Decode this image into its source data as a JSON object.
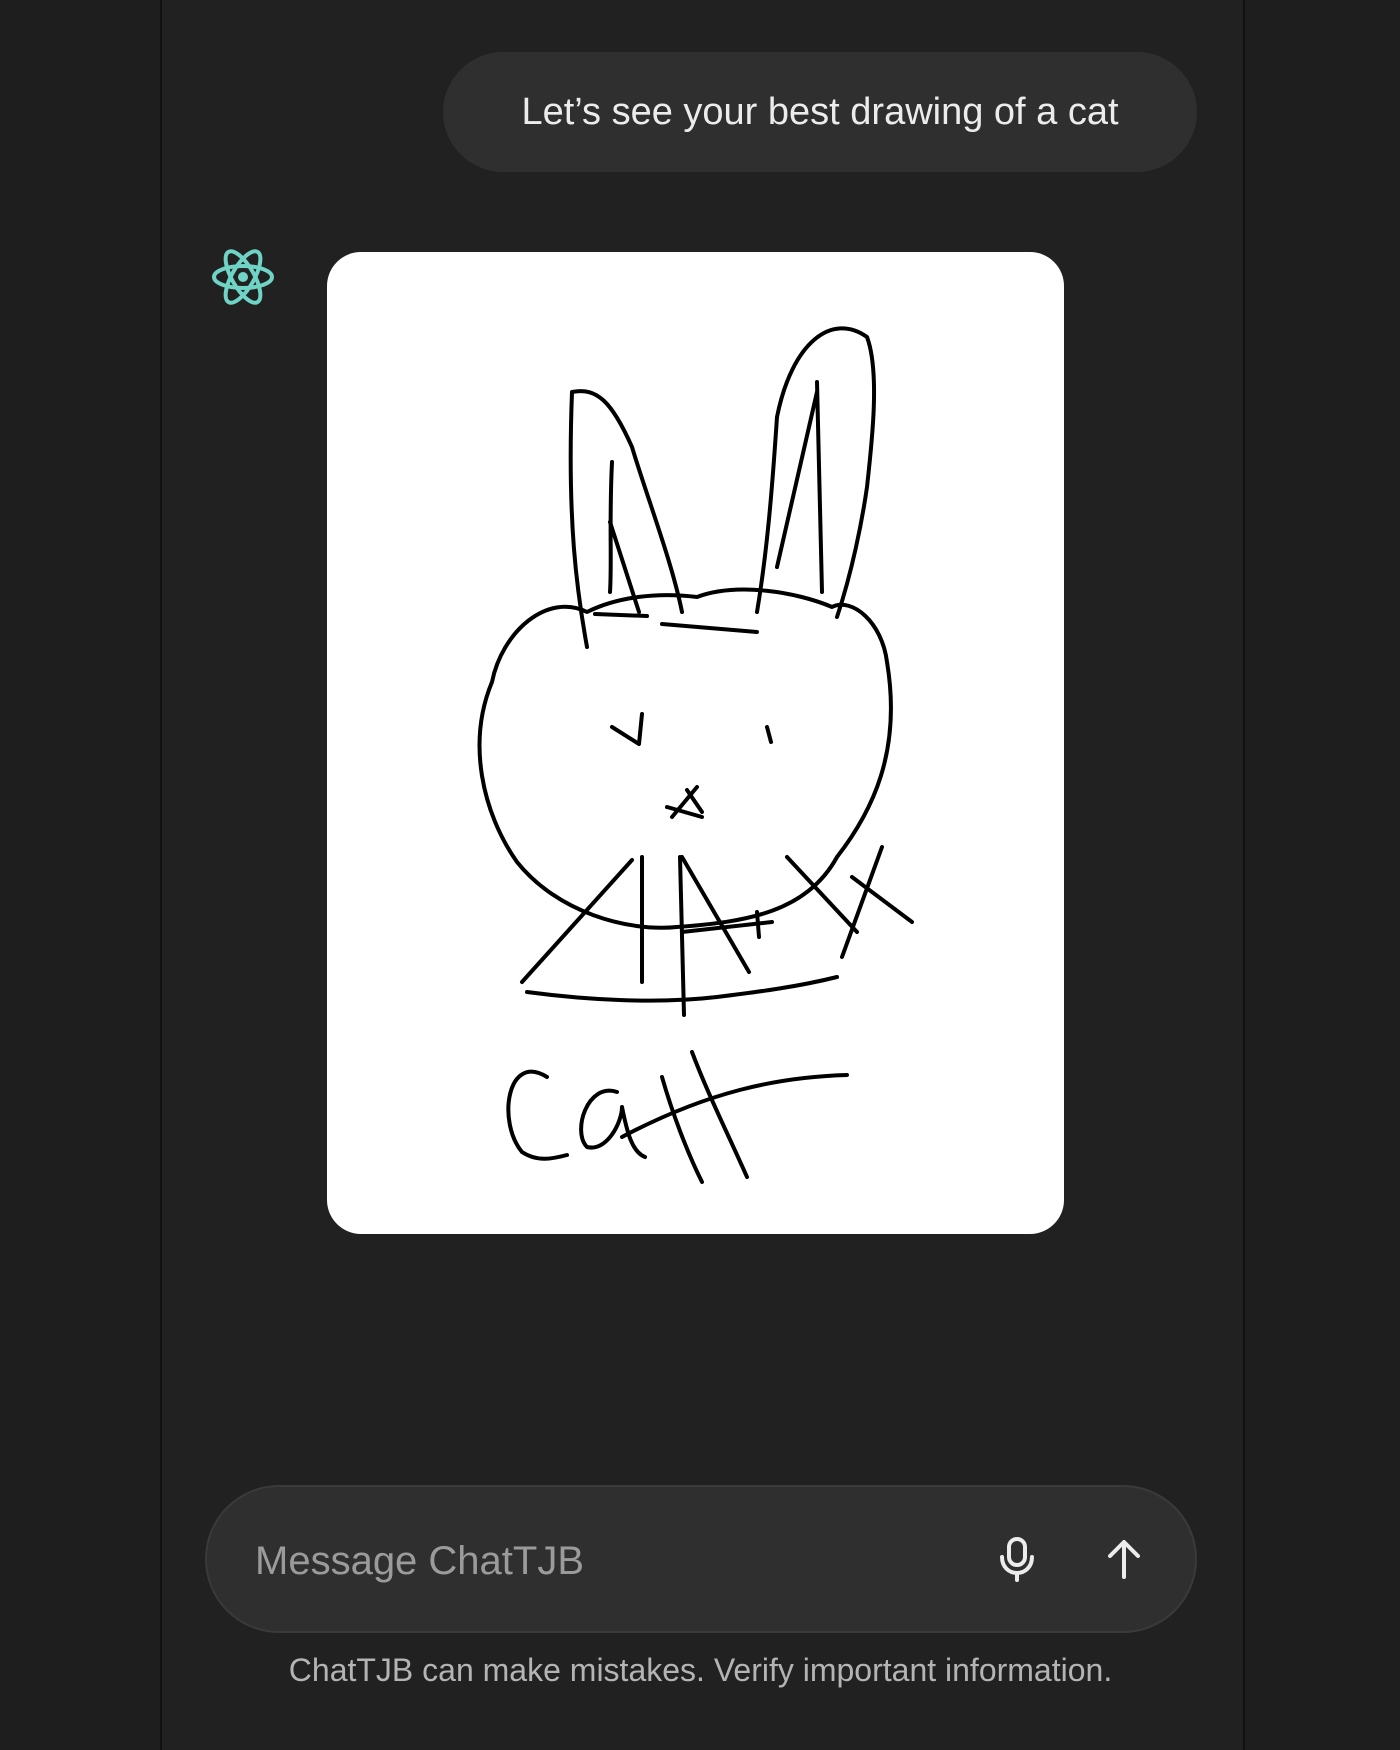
{
  "conversation": {
    "user_message": "Let’s see your best drawing of a cat",
    "assistant_avatar_icon": "atom-icon",
    "assistant_avatar_color": "#6fd3c6",
    "assistant_image": {
      "subject": "drawing",
      "caption_text": "cat"
    }
  },
  "composer": {
    "placeholder": "Message ChatTJB",
    "mic_icon": "microphone-icon",
    "send_icon": "arrow-up-icon"
  },
  "footer": {
    "disclaimer": "ChatTJB can make mistakes. Verify important information."
  },
  "colors": {
    "background": "#212121",
    "bubble": "#2f2f2f",
    "text": "#ececec",
    "muted_text": "#b4b4b4"
  }
}
